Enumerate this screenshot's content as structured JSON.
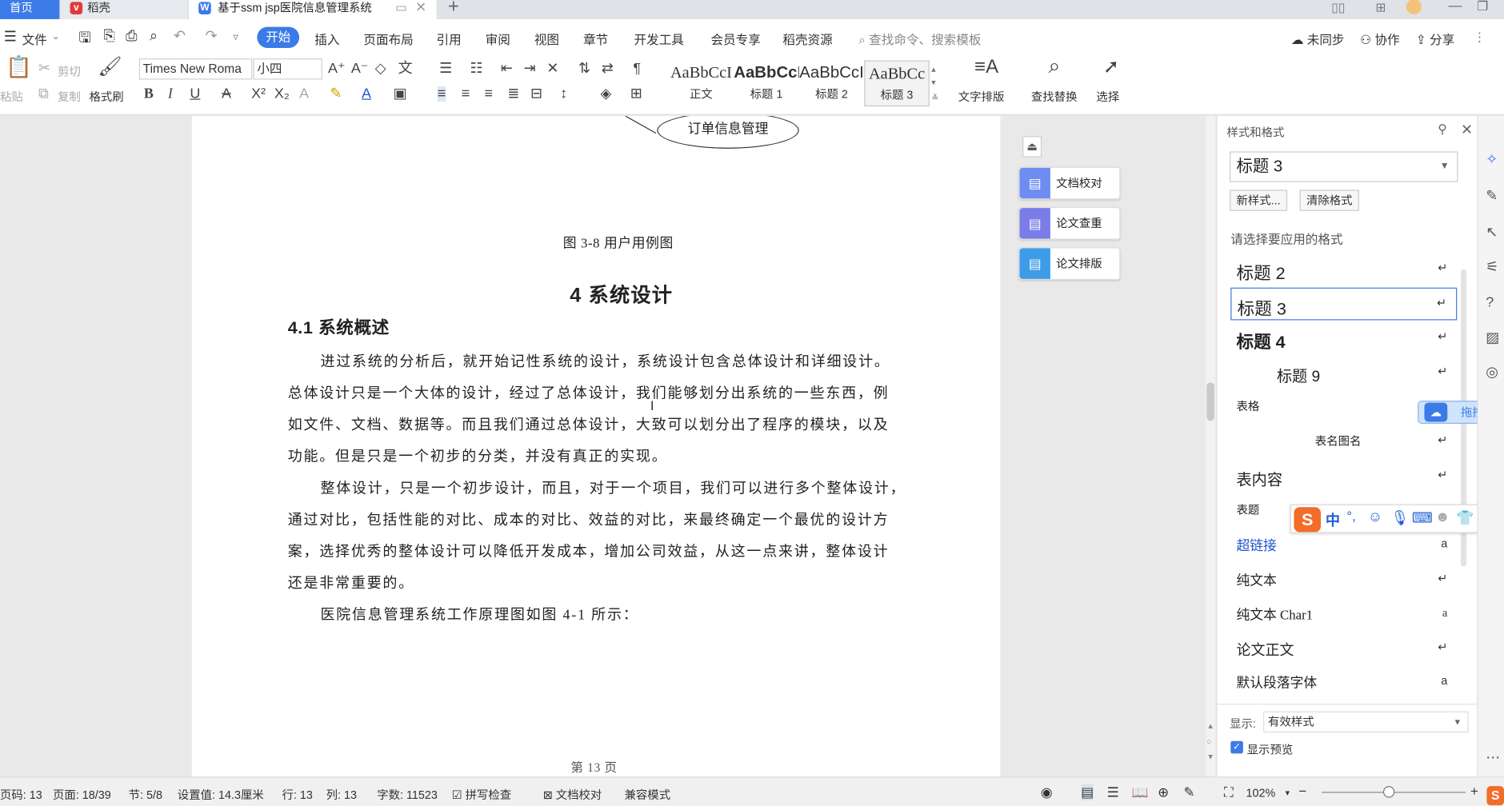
{
  "tabs": {
    "home": "首页",
    "daoke": "稻壳",
    "doc": "基于ssm jsp医院信息管理系统"
  },
  "menu": {
    "file": "文件",
    "items": [
      "开始",
      "插入",
      "页面布局",
      "引用",
      "审阅",
      "视图",
      "章节",
      "开发工具",
      "会员专享",
      "稻壳资源"
    ],
    "search_placeholder": "查找命令、搜索模板",
    "unsynced": "未同步",
    "collab": "协作",
    "share": "分享"
  },
  "ribbon": {
    "paste": "粘贴",
    "cut": "剪切",
    "copy": "复制",
    "format_painter": "格式刷",
    "font_name": "Times New Roma",
    "font_size": "小四",
    "styles": [
      {
        "preview": "AaBbCcI",
        "label": "正文"
      },
      {
        "preview": "AaBbCcI",
        "label": "标题 1"
      },
      {
        "preview": "AaBbCcI",
        "label": "标题 2"
      },
      {
        "preview": "AaBbCc",
        "label": "标题 3"
      }
    ],
    "text_layout": "文字排版",
    "find_replace": "查找替换",
    "select": "选择"
  },
  "document": {
    "diagram_node": "订单信息管理",
    "figure_caption": "图 3-8 用户用例图",
    "chapter_title": "4  系统设计",
    "section_title": "4.1  系统概述",
    "lines": [
      "进过系统的分析后，就开始记性系统的设计，系统设计包含总体设计和详细设计。",
      "总体设计只是一个大体的设计，经过了总体设计，我们能够划分出系统的一些东西，例",
      "如文件、文档、数据等。而且我们通过总体设计，大致可以划分出了程序的模块，以及",
      "功能。但是只是一个初步的分类，并没有真正的实现。",
      "整体设计，只是一个初步设计，而且，对于一个项目，我们可以进行多个整体设计，",
      "通过对比，包括性能的对比、成本的对比、效益的对比，来最终确定一个最优的设计方",
      "案，选择优秀的整体设计可以降低开发成本，增加公司效益，从这一点来讲，整体设计",
      "还是非常重要的。",
      "医院信息管理系统工作原理图如图 4-1 所示："
    ],
    "page_footer": "第  13  页"
  },
  "side_buttons": {
    "proofread": "文档校对",
    "plagiarism": "论文查重",
    "layout": "论文排版"
  },
  "panel": {
    "title": "样式和格式",
    "current_style": "标题  3",
    "new_style": "新样式...",
    "clear_format": "清除格式",
    "choose_label": "请选择要应用的格式",
    "styles": [
      {
        "name": "标题  2",
        "mark": "↵"
      },
      {
        "name": "标题  3",
        "mark": "↵"
      },
      {
        "name": "标题  4",
        "mark": "↵"
      },
      {
        "name": "标题  9",
        "mark": "↵"
      },
      {
        "name": "表格",
        "mark": ""
      },
      {
        "name": "表名图名",
        "mark": "↵"
      },
      {
        "name": "表内容",
        "mark": "↵"
      },
      {
        "name": "表题",
        "mark": ""
      },
      {
        "name": "超链接",
        "mark": "a"
      },
      {
        "name": "纯文本",
        "mark": "↵"
      },
      {
        "name": "纯文本 Char1",
        "mark": "a"
      },
      {
        "name": "论文正文",
        "mark": "↵"
      },
      {
        "name": "默认段落字体",
        "mark": "a"
      }
    ],
    "show_label": "显示:",
    "show_value": "有效样式",
    "preview_label": "显示预览"
  },
  "upload_tip": "拖拽上传",
  "ime": {
    "lang": "中"
  },
  "status": {
    "page_code": "页码: 13",
    "page": "页面: 18/39",
    "section": "节: 5/8",
    "setting": "设置值: 14.3厘米",
    "row": "行: 13",
    "col": "列: 13",
    "words": "字数: 11523",
    "spell": "拼写检查",
    "proof": "文档校对",
    "compat": "兼容模式",
    "zoom": "102%"
  },
  "colors": {
    "accent": "#3b7be8",
    "panel_bg": "#ffffff",
    "doc_bg": "#e9e9e9"
  }
}
